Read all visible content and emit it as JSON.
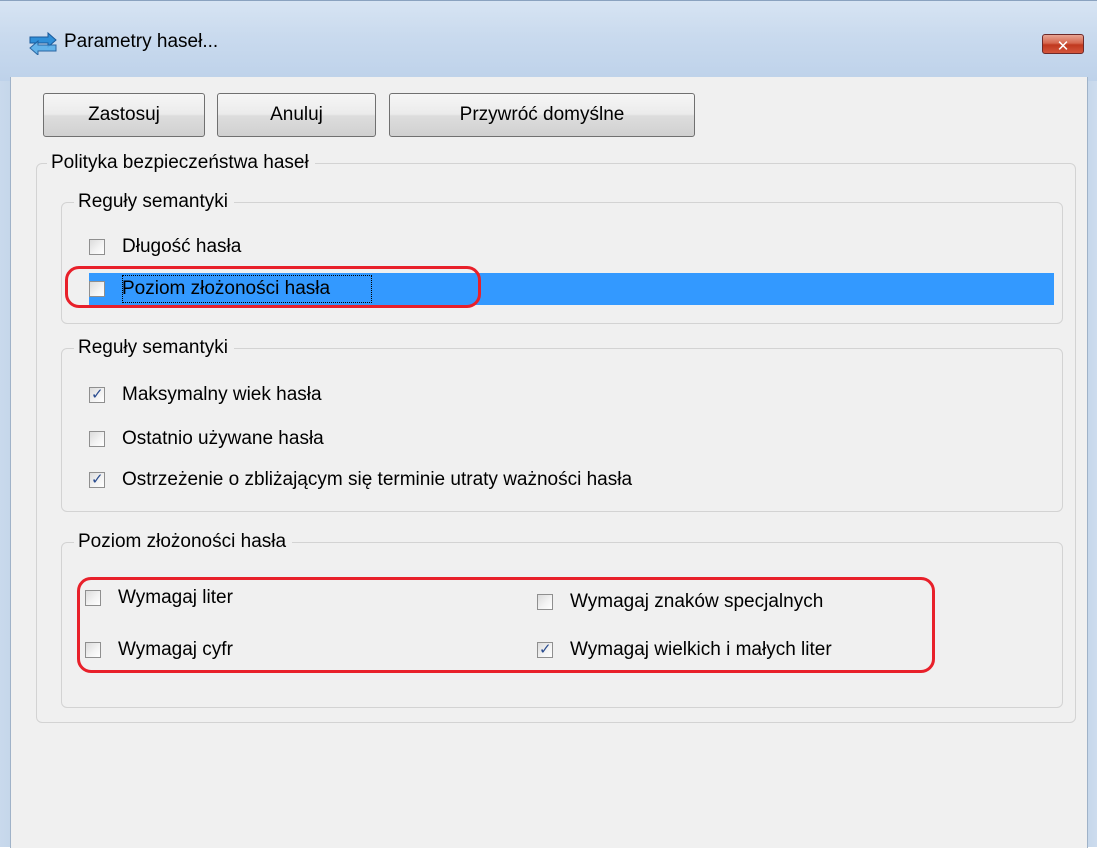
{
  "window": {
    "title": "Parametry haseł...",
    "close_glyph": "✕",
    "title_icon": "password-settings-icon"
  },
  "toolbar": {
    "apply_label": "Zastosuj",
    "cancel_label": "Anuluj",
    "restore_defaults_label": "Przywróć domyślne"
  },
  "policy": {
    "legend": "Polityka bezpieczeństwa haseł",
    "semantics_1": {
      "legend": "Reguły semantyki",
      "items": [
        {
          "label": "Długość hasła",
          "checked": false
        },
        {
          "label": "Poziom złożoności hasła",
          "checked": false,
          "selected": true
        }
      ]
    },
    "semantics_2": {
      "legend": "Reguły semantyki",
      "items": [
        {
          "label": "Maksymalny wiek hasła",
          "checked": true
        },
        {
          "label": "Ostatnio używane hasła",
          "checked": false
        },
        {
          "label": "Ostrzeżenie o zbliżającym się terminie utraty ważności hasła",
          "checked": true
        }
      ]
    },
    "complexity": {
      "legend": "Poziom złożoności hasła",
      "items": [
        {
          "label": "Wymagaj liter",
          "checked": false
        },
        {
          "label": "Wymagaj znaków specjalnych",
          "checked": false
        },
        {
          "label": "Wymagaj cyfr",
          "checked": false
        },
        {
          "label": "Wymagaj wielkich i małych liter",
          "checked": true
        }
      ]
    }
  },
  "colors": {
    "selection": "#3399ff",
    "annotation_ring": "#e8202a",
    "check_mark": "#2a4c8f"
  }
}
